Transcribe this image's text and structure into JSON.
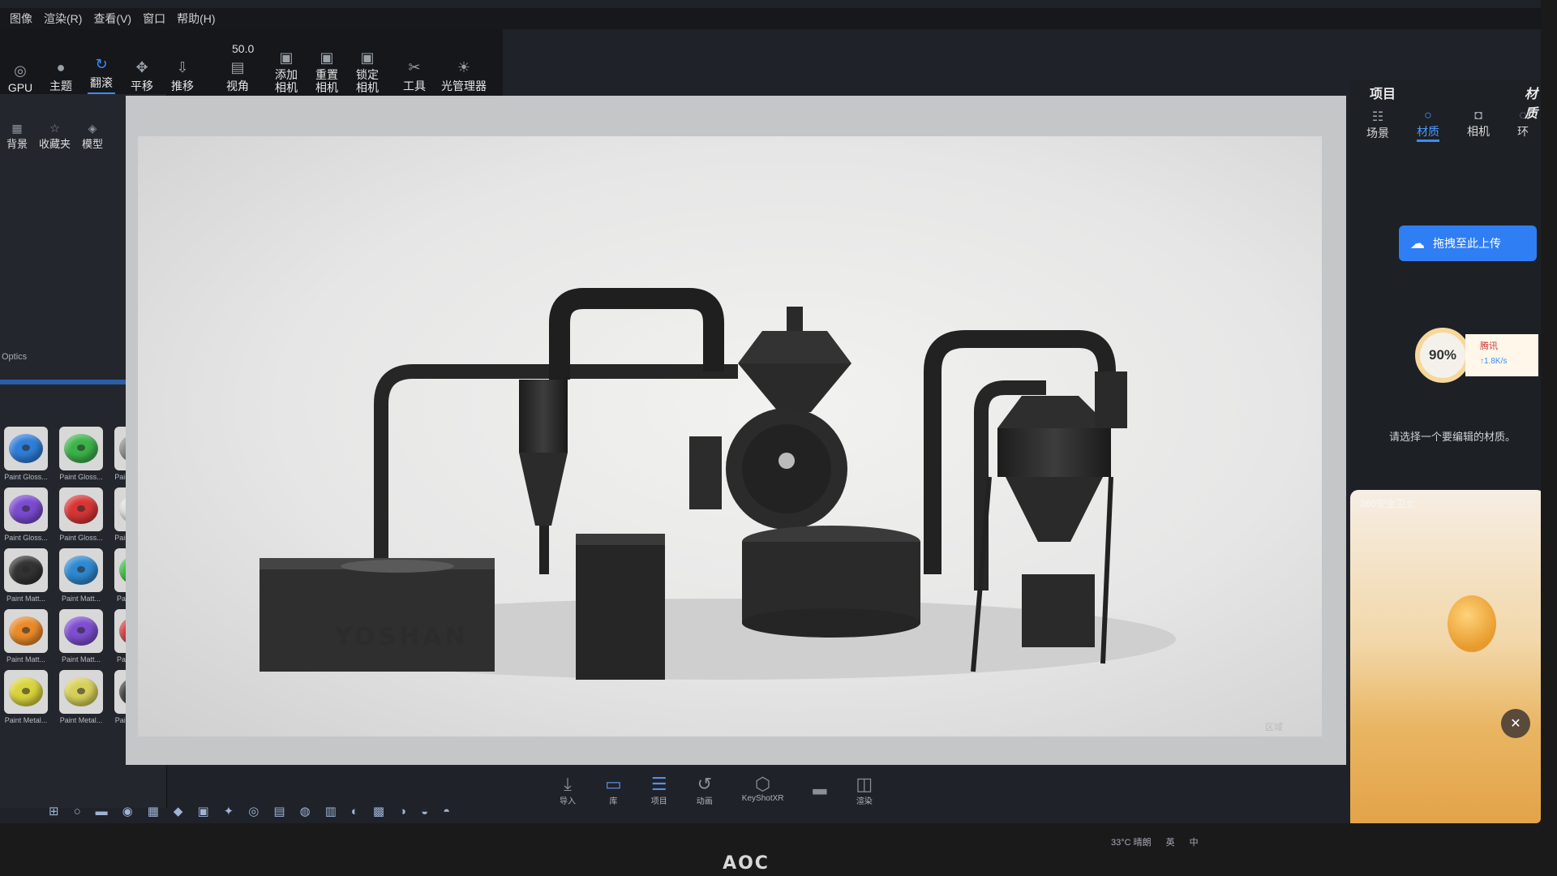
{
  "menubar": [
    "图像",
    "渲染(R)",
    "查看(V)",
    "窗口",
    "帮助(H)"
  ],
  "toolbar": {
    "buttons": [
      {
        "label": "GPU",
        "icon": "gpu-icon"
      },
      {
        "label": "主题",
        "icon": "sphere-icon"
      },
      {
        "label": "翻滚",
        "icon": "tumble-icon"
      },
      {
        "label": "平移",
        "icon": "pan-icon"
      },
      {
        "label": "推移",
        "icon": "dolly-icon"
      },
      {
        "label": "视角",
        "icon": "fov-icon"
      },
      {
        "label": "添加\n相机",
        "icon": "add-camera-icon"
      },
      {
        "label": "重置\n相机",
        "icon": "reset-camera-icon"
      },
      {
        "label": "锁定\n相机",
        "icon": "lock-camera-icon"
      },
      {
        "label": "工具",
        "icon": "tools-icon"
      },
      {
        "label": "光管理器",
        "icon": "light-manager-icon"
      }
    ],
    "zoom_value": "50.0",
    "active": "翻滚"
  },
  "left_panel": {
    "tabs": [
      {
        "label": "背景",
        "icon": "background-icon"
      },
      {
        "label": "收藏夹",
        "icon": "favorites-icon"
      },
      {
        "label": "模型",
        "icon": "model-icon"
      }
    ],
    "section_label": "Optics",
    "swatches": [
      {
        "label": "Paint Gloss...",
        "color": "#2f7ed8"
      },
      {
        "label": "Paint Gloss...",
        "color": "#3cb34a"
      },
      {
        "label": "Paint Gloss...",
        "color": "#8a8a8a"
      },
      {
        "label": "Paint Gloss...",
        "color": "#e77b2a"
      },
      {
        "label": "Paint Gloss...",
        "color": "#7a4bd1"
      },
      {
        "label": "Paint Gloss...",
        "color": "#d93535"
      },
      {
        "label": "Paint Gloss...",
        "color": "#e0e0e0"
      },
      {
        "label": "Paint Gloss...",
        "color": "#e0d030"
      },
      {
        "label": "Paint Matt...",
        "color": "#333333"
      },
      {
        "label": "Paint Matt...",
        "color": "#2e89d1"
      },
      {
        "label": "Paint Matt...",
        "color": "#3dbb42"
      },
      {
        "label": "Paint Matt...",
        "color": "#aaaaaa"
      },
      {
        "label": "Paint Matt...",
        "color": "#ea8a2a"
      },
      {
        "label": "Paint Matt...",
        "color": "#7d4ed0"
      },
      {
        "label": "Paint Matt...",
        "color": "#d43a3a"
      },
      {
        "label": "Paint Matt...",
        "color": "#e7e7e7"
      },
      {
        "label": "Paint Metal...",
        "color": "#d9d33c"
      },
      {
        "label": "Paint Metal...",
        "color": "#d6d05a"
      },
      {
        "label": "Paint Metal...",
        "color": "#3b3b3b"
      },
      {
        "label": "Paint Metal...",
        "color": "#6e6e6e"
      }
    ]
  },
  "viewport": {
    "brand_plate": "YOSHAN",
    "bottom_toolbar": [
      {
        "label": "导入",
        "icon": "import-icon"
      },
      {
        "label": "库",
        "icon": "library-icon"
      },
      {
        "label": "项目",
        "icon": "project-icon"
      },
      {
        "label": "动画",
        "icon": "animation-icon"
      },
      {
        "label": "KeyShotXR",
        "icon": "keyshotxr-icon"
      },
      {
        "label": "",
        "icon": "render-queue-icon"
      },
      {
        "label": "渲染",
        "icon": "render-icon"
      }
    ],
    "region_label": "区域"
  },
  "right_panel": {
    "title": "项目",
    "title2": "材质",
    "tabs": [
      {
        "label": "场景",
        "icon": "scene-icon"
      },
      {
        "label": "材质",
        "icon": "material-icon"
      },
      {
        "label": "相机",
        "icon": "camera-icon"
      },
      {
        "label": "环",
        "icon": "environment-icon"
      }
    ],
    "active_tab": "材质",
    "upload_button": "拖拽至此上传",
    "net_widget": {
      "percent": "90%",
      "app": "腾讯",
      "speed": "↑1.8K/s"
    },
    "hint": "请选择一个要编辑的材质。",
    "ad": {
      "title": "360安全卫士"
    }
  },
  "taskbar": {
    "items": [
      "⊞",
      "○",
      "▬",
      "◉",
      "▦",
      "◆",
      "▣",
      "✦",
      "◎",
      "▤",
      "◍",
      "▥",
      "◐",
      "▩",
      "◑",
      "◒",
      "◓"
    ]
  },
  "tray": [
    "33°C 晴朗",
    "英",
    "中"
  ],
  "monitor_brand": "AOC"
}
